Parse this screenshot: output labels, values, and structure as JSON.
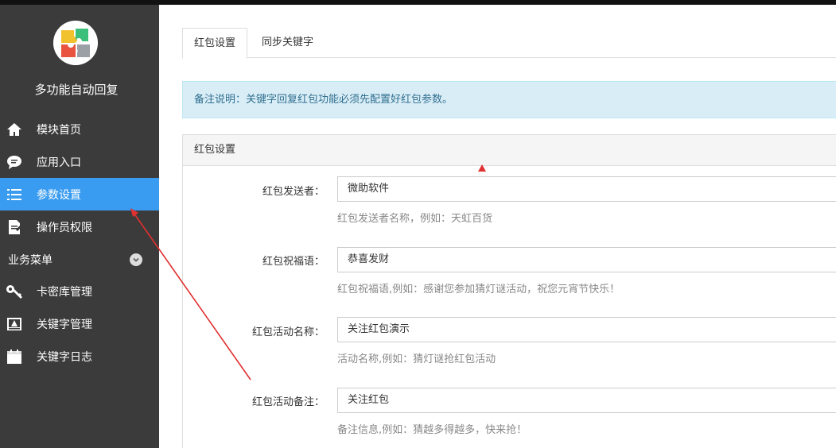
{
  "sidebar": {
    "app_title": "多功能自动回复",
    "items": [
      {
        "label": "模块首页",
        "icon": "home-icon"
      },
      {
        "label": "应用入口",
        "icon": "chat-icon"
      },
      {
        "label": "参数设置",
        "icon": "list-icon",
        "active": true
      },
      {
        "label": "操作员权限",
        "icon": "document-edit-icon"
      }
    ],
    "group_label": "业务菜单",
    "group_items": [
      {
        "label": "卡密库管理",
        "icon": "key-icon"
      },
      {
        "label": "关键字管理",
        "icon": "id-card-icon"
      },
      {
        "label": "关键字日志",
        "icon": "calendar-icon"
      }
    ]
  },
  "tabs": [
    {
      "label": "红包设置",
      "active": true
    },
    {
      "label": "同步关键字",
      "active": false
    }
  ],
  "alert": {
    "text": "备注说明：关键字回复红包功能必须先配置好红包参数。"
  },
  "panel": {
    "title": "红包设置",
    "fields": [
      {
        "label": "红包发送者：",
        "value": "微助软件",
        "help": "红包发送者名称，例如：天虹百货"
      },
      {
        "label": "红包祝福语：",
        "value": "恭喜发财",
        "help": "红包祝福语,例如：感谢您参加猜灯谜活动，祝您元宵节快乐！"
      },
      {
        "label": "红包活动名称：",
        "value": "关注红包演示",
        "help": "活动名称,例如：猜灯谜抢红包活动"
      },
      {
        "label": "红包活动备注：",
        "value": "关注红包",
        "help": "备注信息,例如：猜越多得越多，快来抢！"
      }
    ]
  },
  "colors": {
    "sidebar_bg": "#3b3b3b",
    "active_bg": "#3a9cf0",
    "annotation": "#e03030",
    "alert_bg": "#d9edf7"
  }
}
